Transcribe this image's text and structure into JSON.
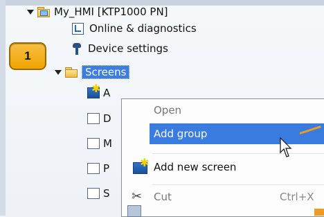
{
  "badge": {
    "number": "1",
    "color": "#f0a400"
  },
  "tree": {
    "device": "My_HMI [KTP1000 PN]",
    "online_diagnostics": "Online & diagnostics",
    "device_settings": "Device settings",
    "screens_folder": "Screens",
    "child_initials": [
      "A",
      "D",
      "M",
      "P",
      "S"
    ]
  },
  "context_menu": {
    "open": "Open",
    "add_group": "Add group",
    "add_new_screen": "Add new screen",
    "cut": "Cut",
    "cut_shortcut": "Ctrl+X"
  },
  "colors": {
    "selection": "#3d7de0",
    "menu_highlight": "#3a7be0",
    "accent_orange": "#f09a20"
  },
  "icons": [
    "folder-icon",
    "diagnostics-icon",
    "wrench-icon",
    "screen-icon",
    "scissors-icon",
    "cursor-icon"
  ]
}
